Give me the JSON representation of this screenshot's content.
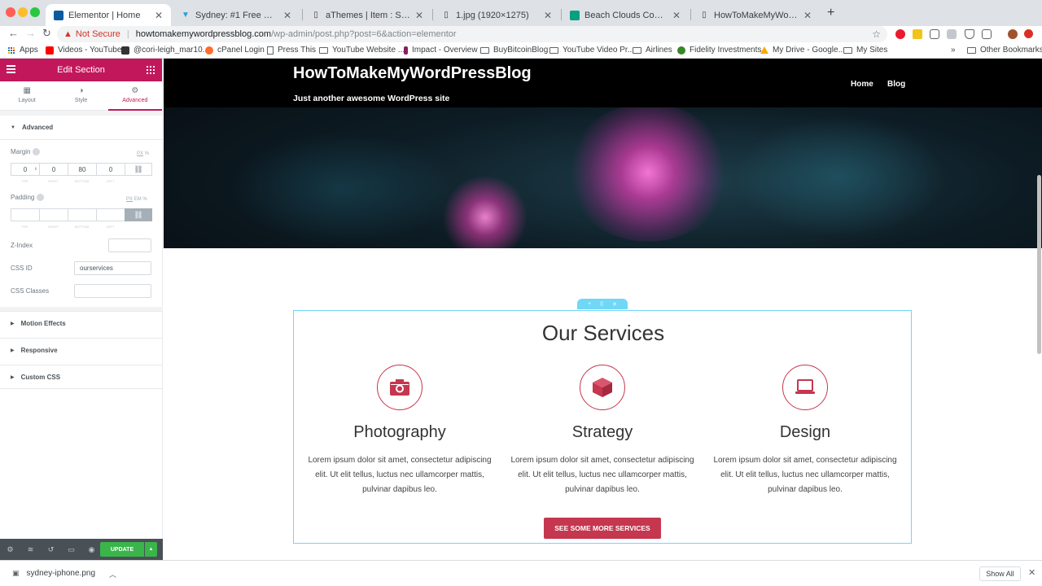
{
  "browser": {
    "tabs": [
      {
        "title": "Elementor | Home",
        "active": true,
        "color": "#0c5b9e"
      },
      {
        "title": "Sydney: #1 Free WordPress Bu",
        "active": false,
        "color": "#1fa0e0"
      },
      {
        "title": "aThemes | Item : Sydney",
        "active": false,
        "color": "#777777"
      },
      {
        "title": "1.jpg (1920×1275)",
        "active": false,
        "color": "#777777"
      },
      {
        "title": "Beach Clouds Couple - Free p",
        "active": false,
        "color": "#05a081"
      },
      {
        "title": "HowToMakeMyWordPressBlog",
        "active": false,
        "color": "#777777"
      }
    ],
    "security_label": "Not Secure",
    "url_host": "howtomakemywordpressblog.com",
    "url_path": "/wp-admin/post.php?post=6&action=elementor",
    "bookmarks": [
      {
        "label": "Apps",
        "kind": "apps"
      },
      {
        "label": "Videos - YouTube",
        "kind": "youtube"
      },
      {
        "label": "@cori-leigh_mar10...",
        "kind": "site"
      },
      {
        "label": "cPanel Login",
        "kind": "cpanel"
      },
      {
        "label": "Press This",
        "kind": "page"
      },
      {
        "label": "YouTube Website ...",
        "kind": "folder"
      },
      {
        "label": "Impact - Overview",
        "kind": "impact"
      },
      {
        "label": "BuyBitcoinBlog",
        "kind": "folder"
      },
      {
        "label": "YouTube Video Pr...",
        "kind": "folder"
      },
      {
        "label": "Airlines",
        "kind": "folder"
      },
      {
        "label": "Fidelity Investments",
        "kind": "fidelity"
      },
      {
        "label": "My Drive - Google...",
        "kind": "drive"
      },
      {
        "label": "My Sites",
        "kind": "folder"
      }
    ],
    "more_bookmarks": "»",
    "other_bookmarks": "Other Bookmarks"
  },
  "panel": {
    "title": "Edit Section",
    "tabs": [
      {
        "label": "Layout",
        "icon": "layout-icon"
      },
      {
        "label": "Style",
        "icon": "style-icon"
      },
      {
        "label": "Advanced",
        "icon": "gear-icon"
      }
    ],
    "active_tab": "Advanced",
    "section_advanced": "Advanced",
    "margin_label": "Margin",
    "padding_label": "Padding",
    "unit_px": "PX",
    "unit_pct": "%",
    "unit_em": "EM",
    "margin_values": {
      "top": "0",
      "right": "0",
      "bottom": "80",
      "left": "0"
    },
    "dim_labels": {
      "top": "TOP",
      "right": "RIGHT",
      "bottom": "BOTTOM",
      "left": "LEFT"
    },
    "zindex_label": "Z-Index",
    "cssid_label": "CSS ID",
    "cssid_value": "ourservices",
    "cssclasses_label": "CSS Classes",
    "motion_effects": "Motion Effects",
    "responsive": "Responsive",
    "custom_css": "Custom CSS",
    "update_label": "UPDATE",
    "accent": "#c2185b",
    "update_color": "#39b54a"
  },
  "site": {
    "title": "HowToMakeMyWordPressBlog",
    "tagline": "Just another awesome WordPress site",
    "nav": [
      "Home",
      "Blog"
    ],
    "services_title": "Our Services",
    "services": [
      {
        "title": "Photography",
        "icon": "camera-icon",
        "text": "Lorem ipsum dolor sit amet, consectetur adipiscing elit. Ut elit tellus, luctus nec ullamcorper mattis, pulvinar dapibus leo."
      },
      {
        "title": "Strategy",
        "icon": "cube-icon",
        "text": "Lorem ipsum dolor sit amet, consectetur adipiscing elit. Ut elit tellus, luctus nec ullamcorper mattis, pulvinar dapibus leo."
      },
      {
        "title": "Design",
        "icon": "laptop-icon",
        "text": "Lorem ipsum dolor sit amet, consectetur adipiscing elit. Ut elit tellus, luctus nec ullamcorper mattis, pulvinar dapibus leo."
      }
    ],
    "button_label": "SEE SOME MORE SERVICES",
    "accent": "#c5364f",
    "section_outline": "#71d7f7"
  },
  "downloads": {
    "filename": "sydney-iphone.png",
    "show_all": "Show All"
  }
}
